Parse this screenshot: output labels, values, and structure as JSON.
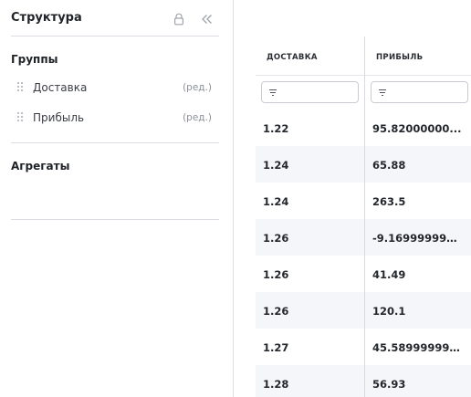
{
  "panel": {
    "title": "Структура",
    "groups_title": "Группы",
    "groups": [
      {
        "label": "Доставка",
        "edit": "(ред.)"
      },
      {
        "label": "Прибыль",
        "edit": "(ред.)"
      }
    ],
    "aggregates_title": "Агрегаты"
  },
  "table": {
    "columns": [
      "ДОСТАВКА",
      "ПРИБЫЛЬ"
    ],
    "rows": [
      [
        "1.22",
        "95.82000000..."
      ],
      [
        "1.24",
        "65.88"
      ],
      [
        "1.24",
        "263.5"
      ],
      [
        "1.26",
        "-9.169999999..."
      ],
      [
        "1.26",
        "41.49"
      ],
      [
        "1.26",
        "120.1"
      ],
      [
        "1.27",
        "45.589999999..."
      ],
      [
        "1.28",
        "56.93"
      ]
    ]
  }
}
